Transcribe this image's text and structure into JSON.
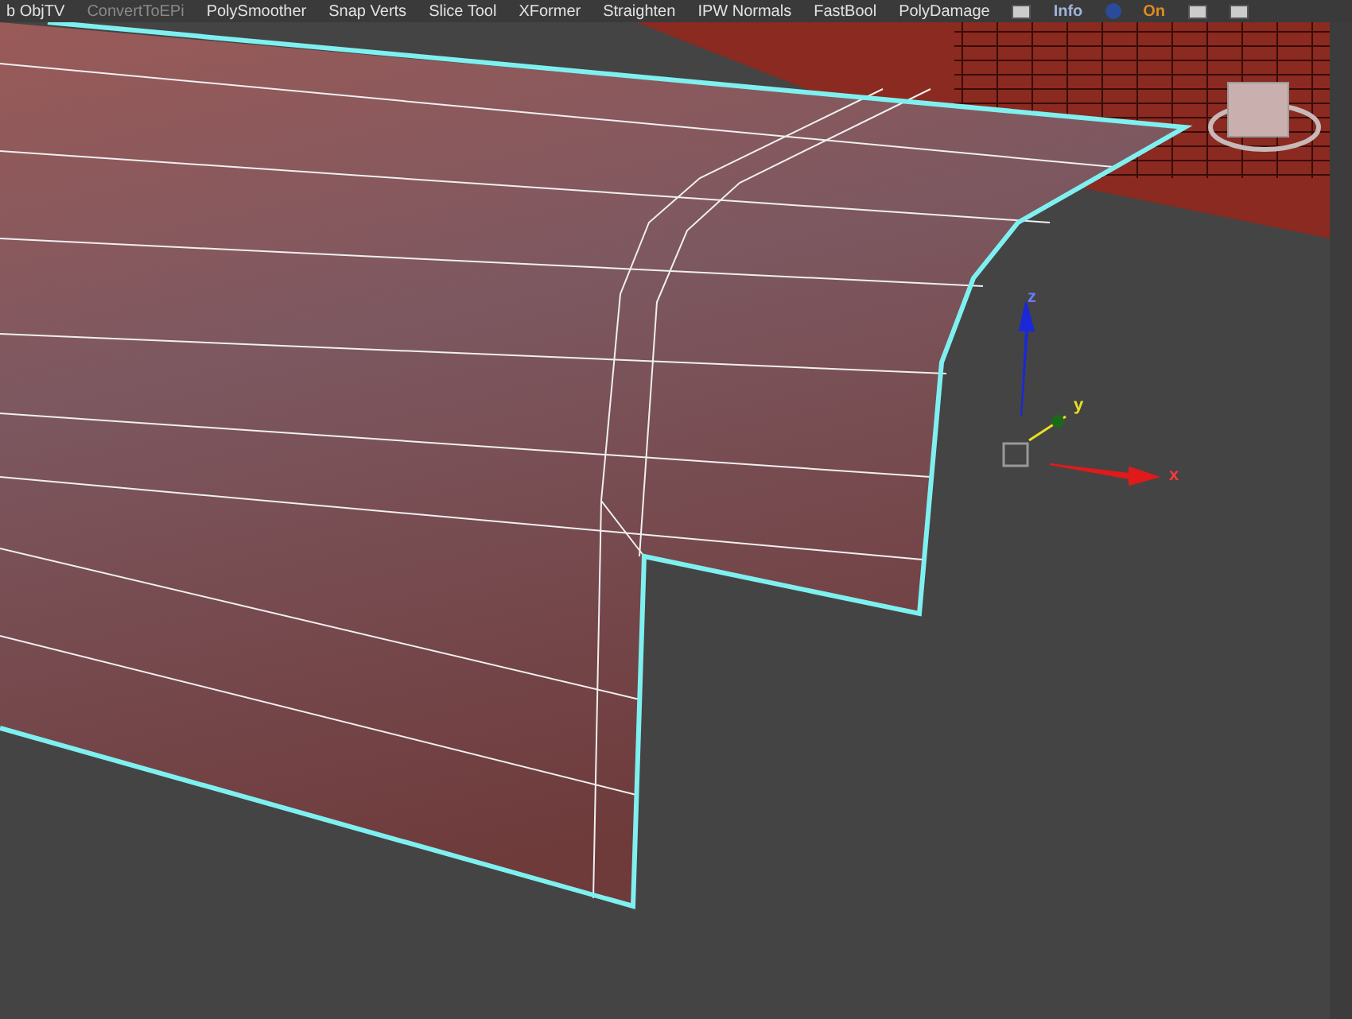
{
  "toolbar": {
    "items": [
      {
        "label": "b ObjTV",
        "disabled": false
      },
      {
        "label": "ConvertToEPi",
        "disabled": true
      },
      {
        "label": "PolySmoother",
        "disabled": false
      },
      {
        "label": "Snap Verts",
        "disabled": false
      },
      {
        "label": "Slice Tool",
        "disabled": false
      },
      {
        "label": "XFormer",
        "disabled": false
      },
      {
        "label": "Straighten",
        "disabled": false
      },
      {
        "label": "IPW Normals",
        "disabled": false
      },
      {
        "label": "FastBool",
        "disabled": false
      },
      {
        "label": "PolyDamage",
        "disabled": false
      }
    ],
    "info_label": "Info",
    "status_label": "On"
  },
  "viewport": {
    "gizmo_labels": [
      "z",
      "y",
      "x"
    ]
  }
}
